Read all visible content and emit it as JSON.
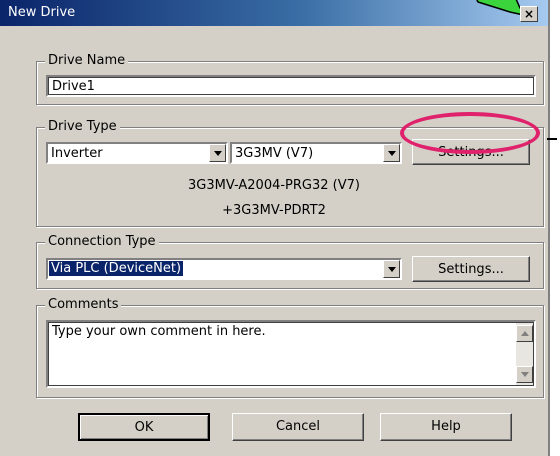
{
  "window": {
    "title": "New Drive",
    "close_label": "×"
  },
  "drive_name": {
    "label": "Drive Name",
    "value": "Drive1"
  },
  "drive_type": {
    "label": "Drive Type",
    "type_value": "Inverter",
    "model_value": "3G3MV (V7)",
    "settings_label": "Settings...",
    "info_line1": "3G3MV-A2004-PRG32 (V7)",
    "info_line2": "+3G3MV-PDRT2"
  },
  "connection_type": {
    "label": "Connection Type",
    "value": "Via PLC (DeviceNet)",
    "settings_label": "Settings..."
  },
  "comments": {
    "label": "Comments",
    "value": "Type your own comment in here."
  },
  "buttons": {
    "ok": "OK",
    "cancel": "Cancel",
    "help": "Help"
  },
  "colors": {
    "highlight": "#e0216b",
    "titlebar": "#0a246a",
    "arrow": "#3cd43c"
  }
}
